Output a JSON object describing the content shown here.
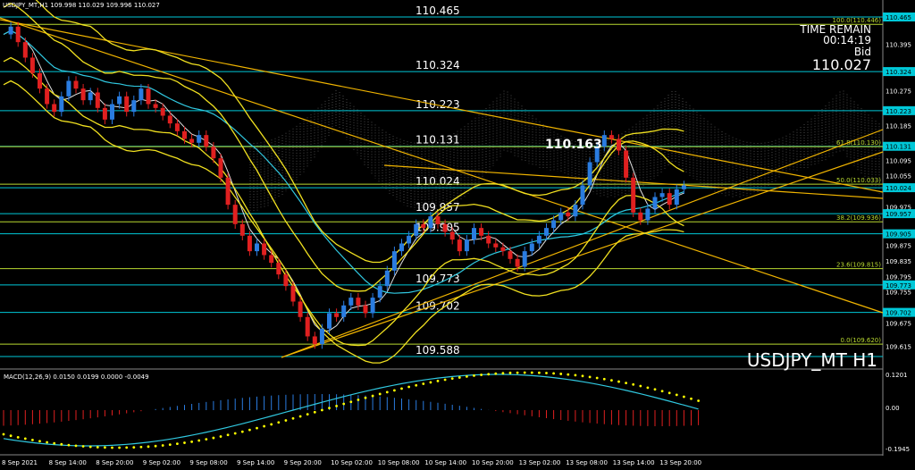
{
  "header": {
    "symbol_info": "USDJPY_MT,H1  109.998 110.029 109.996 110.027"
  },
  "info_panel": {
    "time_remain_label": "TIME REMAIN",
    "time_remain": "00:14:19",
    "bid_label": "Bid",
    "bid_value": "110.027"
  },
  "watermark": "USDJPY_MT H1",
  "peak_label": "110.163",
  "level_labels": [
    "110.465",
    "110.324",
    "110.223",
    "110.131",
    "110.024",
    "109.957",
    "109.905",
    "109.773",
    "109.702",
    "109.588"
  ],
  "price_axis": [
    "110.465",
    "110.395",
    "110.324",
    "110.275",
    "110.223",
    "110.185",
    "110.131",
    "110.095",
    "110.055",
    "110.024",
    "109.975",
    "109.957",
    "109.905",
    "109.875",
    "109.835",
    "109.795",
    "109.773",
    "109.755",
    "109.702",
    "109.675",
    "109.615"
  ],
  "price_axis_tags": [
    "110.465",
    "110.324",
    "110.223",
    "110.131",
    "110.024",
    "109.957",
    "109.905",
    "109.773",
    "109.702"
  ],
  "fib_labels": [
    "100.0(110.446)",
    "61.8(110.130)",
    "50.0(110.033)",
    "38.2(109.936)",
    "23.6(109.815)",
    "0.0(109.620)"
  ],
  "indicator": {
    "label": "MACD(12,26,9) 0.0150 0.0199 0.0000 -0.0049",
    "axis": [
      "0.1201",
      "0.00",
      "-0.1945"
    ]
  },
  "time_axis": [
    "8 Sep 2021",
    "8 Sep 14:00",
    "8 Sep 20:00",
    "9 Sep 02:00",
    "9 Sep 08:00",
    "9 Sep 14:00",
    "9 Sep 20:00",
    "10 Sep 02:00",
    "10 Sep 08:00",
    "10 Sep 14:00",
    "10 Sep 20:00",
    "13 Sep 02:00",
    "13 Sep 08:00",
    "13 Sep 14:00",
    "13 Sep 20:00"
  ],
  "colors": {
    "bull": "#2a7ce0",
    "bear": "#e02020",
    "level_line": "#00c8d8",
    "fib_line": "#b8d830",
    "trend_line": "#f0b400",
    "bands": "#f0e020",
    "ma_white": "#e0e0e0",
    "ma_cyan": "#30c8e0",
    "macd_signal": "#ffff00"
  }
}
